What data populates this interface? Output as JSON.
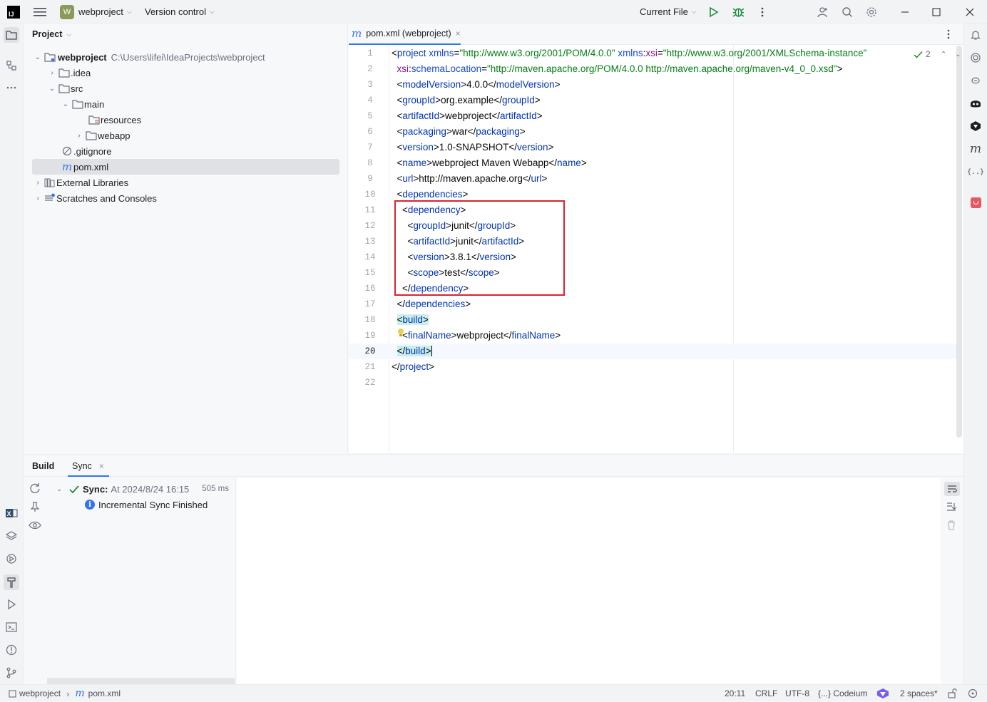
{
  "titlebar": {
    "project_badge": "W",
    "project_name": "webproject",
    "vcs": "Version control",
    "run_config": "Current File",
    "brand_color": "#8a9a5b"
  },
  "project_panel": {
    "title": "Project",
    "tree": [
      {
        "label": "webproject",
        "path": "C:\\Users\\lifei\\IdeaProjects\\webproject",
        "arrow": "down",
        "icon": "module-folder-icon"
      },
      {
        "label": ".idea",
        "arrow": "right",
        "icon": "folder-icon"
      },
      {
        "label": "src",
        "arrow": "down",
        "icon": "folder-icon"
      },
      {
        "label": "main",
        "arrow": "down",
        "icon": "folder-icon"
      },
      {
        "label": "resources",
        "arrow": "",
        "icon": "resources-folder-icon"
      },
      {
        "label": "webapp",
        "arrow": "right",
        "icon": "folder-icon"
      },
      {
        "label": ".gitignore",
        "arrow": "",
        "icon": "ignore-file-icon"
      },
      {
        "label": "pom.xml",
        "arrow": "",
        "icon": "maven-file-icon",
        "selected": true
      },
      {
        "label": "External Libraries",
        "arrow": "right",
        "icon": "libraries-icon"
      },
      {
        "label": "Scratches and Consoles",
        "arrow": "right",
        "icon": "scratches-icon"
      }
    ]
  },
  "editor": {
    "tab_label": "pom.xml (webproject)",
    "inspection_count": "2",
    "current_line": "20",
    "line_numbers": [
      "1",
      "2",
      "3",
      "4",
      "5",
      "6",
      "7",
      "8",
      "9",
      "10",
      "11",
      "12",
      "13",
      "14",
      "15",
      "16",
      "17",
      "18",
      "19",
      "20",
      "21",
      "22"
    ]
  },
  "build_panel": {
    "tabs": [
      "Build",
      "Sync"
    ],
    "sync_label": "Sync:",
    "sync_time": "At 2024/8/24 16:15",
    "sync_duration": "505 ms",
    "message": "Incremental Sync Finished"
  },
  "statusbar": {
    "breadcrumb_project": "webproject",
    "breadcrumb_file": "pom.xml",
    "position": "20:11",
    "line_sep": "CRLF",
    "encoding": "UTF-8",
    "codeium": "{...} Codeium",
    "indent": "2 spaces*"
  }
}
